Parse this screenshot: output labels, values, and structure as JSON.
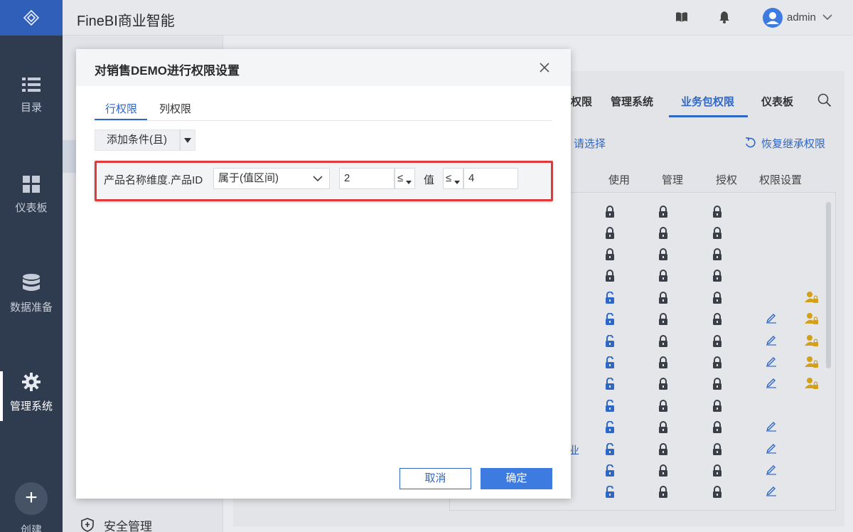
{
  "app": {
    "title": "FineBI商业智能",
    "user": "admin"
  },
  "rail": {
    "items": [
      {
        "label": "目录",
        "icon": "list-icon"
      },
      {
        "label": "仪表板",
        "icon": "dashboard-icon"
      },
      {
        "label": "数据准备",
        "icon": "database-icon"
      },
      {
        "label": "管理系统",
        "icon": "gear-icon"
      }
    ],
    "create_label": "创建"
  },
  "side": {
    "security_label": "安全管理"
  },
  "background": {
    "tabs": [
      "权限",
      "管理系统",
      "业务包权限",
      "仪表板"
    ],
    "active_tab": "业务包权限",
    "select_placeholder": "请选择",
    "restore_label": "恢复继承权限",
    "columns": [
      "使用",
      "管理",
      "授权",
      "权限设置"
    ],
    "row_tail_text": "业"
  },
  "dialog": {
    "title": "对销售DEMO进行权限设置",
    "tabs": [
      "行权限",
      "列权限"
    ],
    "active_tab": "行权限",
    "add_condition_label": "添加条件(且)",
    "condition": {
      "field": "产品名称维度.产品ID",
      "operator": "属于(值区间)",
      "min_value": "2",
      "min_op": "≤",
      "value_label": "值",
      "max_op": "≤",
      "max_value": "4"
    },
    "cancel_label": "取消",
    "ok_label": "确定"
  },
  "colors": {
    "accent": "#3d7be0",
    "highlight": "#e03a3a",
    "rail": "#2f3b4e",
    "lock_open": "#2f67c6",
    "user_badge": "#d4a017"
  }
}
